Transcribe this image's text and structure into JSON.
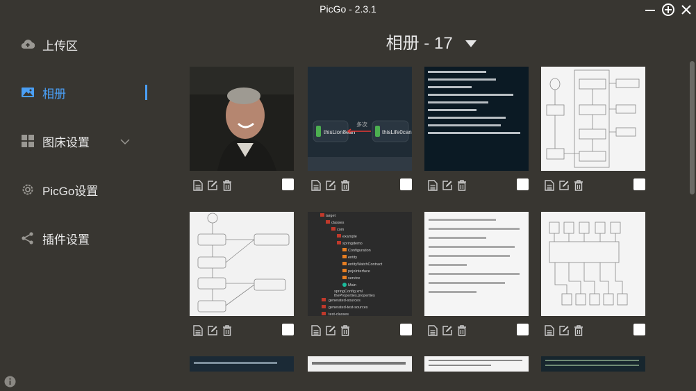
{
  "window": {
    "title": "PicGo - 2.3.1",
    "controls": [
      "minimize-icon",
      "maximize-icon",
      "close-icon"
    ]
  },
  "sidebar": {
    "items": [
      {
        "label": "上传区",
        "icon": "cloud-upload-icon",
        "active": false
      },
      {
        "label": "相册",
        "icon": "image-icon",
        "active": true
      },
      {
        "label": "图床设置",
        "icon": "grid-icon",
        "active": false,
        "expandable": true
      },
      {
        "label": "PicGo设置",
        "icon": "gear-icon",
        "active": false
      },
      {
        "label": "插件设置",
        "icon": "share-icon",
        "active": false
      }
    ],
    "info_icon": "info-icon"
  },
  "main": {
    "album_title": "相册 - 17",
    "images": [
      {
        "kind": "photo"
      },
      {
        "kind": "diagram-dark",
        "labels": [
          "thisLion8ean",
          "thisLife0can"
        ],
        "arrow_label": "多次"
      },
      {
        "kind": "code"
      },
      {
        "kind": "flowchart"
      },
      {
        "kind": "flowchart"
      },
      {
        "kind": "file-tree",
        "lines": [
          "target",
          "classes",
          "com",
          "example",
          "springdemo",
          "Configuration",
          "entity",
          "entityWatchContract",
          "pojoInterface",
          "service",
          "Main",
          "springConfig.xml",
          "theProperties.properties",
          "generated-sources",
          "generated-test-sources",
          "test-classes"
        ]
      },
      {
        "kind": "text"
      },
      {
        "kind": "block-diagram"
      },
      {
        "kind": "partial-dark"
      },
      {
        "kind": "partial-text"
      },
      {
        "kind": "partial-text"
      },
      {
        "kind": "partial-dark"
      }
    ]
  },
  "colors": {
    "background": "#383631",
    "accent": "#4a9ff5",
    "text": "#e8e8e8"
  }
}
